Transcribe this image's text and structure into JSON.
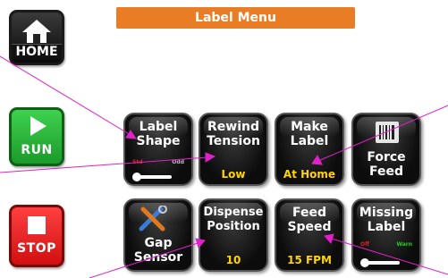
{
  "title": "Label Menu",
  "side": {
    "home_label": "HOME",
    "run_label": "RUN",
    "stop_label": "STOP"
  },
  "tiles": {
    "label_shape": {
      "label_line1": "Label",
      "label_line2": "Shape",
      "opt_left": "Std",
      "opt_right": "Odd"
    },
    "rewind_tension": {
      "label_line1": "Rewind",
      "label_line2": "Tension",
      "value": "Low"
    },
    "make_label": {
      "label_line1": "Make",
      "label_line2": "Label",
      "value": "At Home"
    },
    "force_feed": {
      "label_line1": "Force",
      "label_line2": "Feed"
    },
    "gap_sensor": {
      "label_line1": "Gap",
      "label_line2": "Sensor"
    },
    "dispense_position": {
      "label_line1": "Dispense",
      "label_line2": "Position",
      "value": "10"
    },
    "feed_speed": {
      "label_line1": "Feed",
      "label_line2": "Speed",
      "value": "15 FPM"
    },
    "missing_label": {
      "label_line1": "Missing",
      "label_line2": "Label",
      "opt_left": "Off",
      "opt_right": "Warn"
    }
  },
  "colors": {
    "title_bar": "#e87d25",
    "run": "#2cb83c",
    "stop": "#e81818",
    "value_text": "#ffd400",
    "pointer": "#e020c8"
  }
}
